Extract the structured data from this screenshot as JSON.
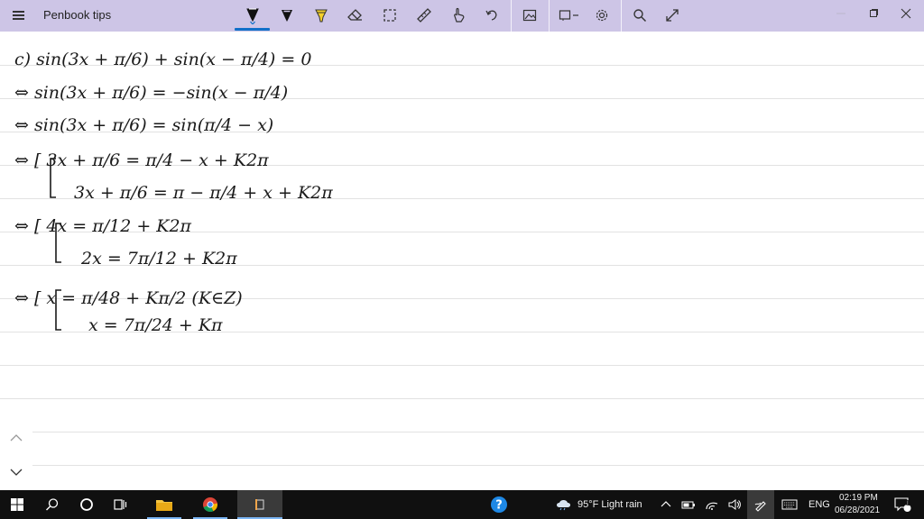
{
  "window": {
    "title": "Penbook tips"
  },
  "toolbar": {
    "tools": [
      "pen-icon",
      "pen-icon",
      "highlighter-icon",
      "eraser-icon",
      "lasso-select-icon",
      "ruler-icon",
      "touch-writing-icon",
      "undo-icon",
      "image-icon",
      "shape-icon",
      "settings-gear-icon",
      "search-icon",
      "fullscreen-expand-icon"
    ],
    "active_tool_color": "#1170c8"
  },
  "window_controls": [
    "minimize-icon",
    "maximize-icon",
    "close-icon"
  ],
  "handwriting": {
    "lines": [
      "c) sin(3x + π/6) + sin(x − π/4) = 0",
      "⇔ sin(3x + π/6) = −sin(x − π/4)",
      "⇔ sin(3x + π/6) = sin(π/4 − x)",
      "⇔ [ 3x + π/6 = π/4 − x + K2π",
      "3x + π/6 = π − π/4 + x + K2π",
      "⇔ [ 4x = π/12 + K2π",
      "2x = 7π/12 + K2π",
      "⇔ [ x = π/48 + Kπ/2 (K∈Z)",
      "x = 7π/24 + Kπ"
    ],
    "ink_color": "#1a1a1a"
  },
  "page_nav": {
    "up": "chevron-up-icon",
    "down": "chevron-down-icon"
  },
  "taskbar": {
    "weather": "95°F  Light rain",
    "language": "ENG",
    "time": "02:19 PM",
    "date": "06/28/2021",
    "notification_count": "1",
    "accent": "#7cb6f5"
  }
}
